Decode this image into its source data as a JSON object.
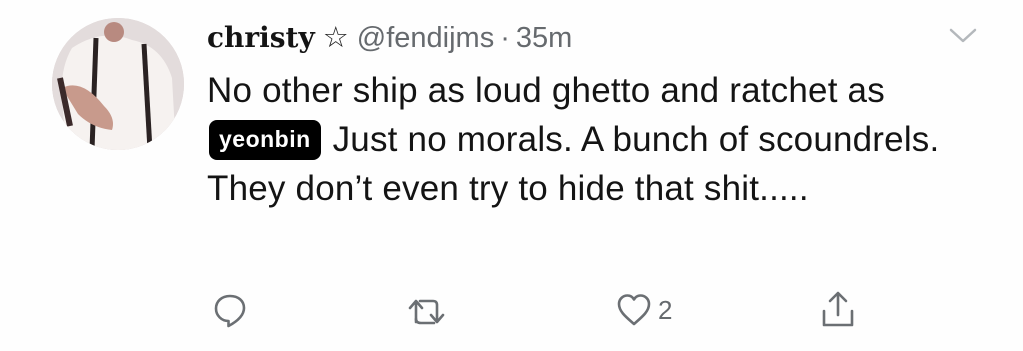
{
  "tweet": {
    "display_name": "christy",
    "star": "☆",
    "handle": "@fendijms",
    "separator": "·",
    "time": "35m",
    "text_before": "No other ship as loud ghetto and ratchet as",
    "redacted_label": "yeonbin",
    "text_after": "Just no morals. A bunch of scoundrels. They don’t even try to hide that shit.....",
    "avatar_icon": "profile-avatar"
  },
  "actions": {
    "reply_icon": "reply-icon",
    "retweet_icon": "retweet-icon",
    "like_icon": "heart-icon",
    "like_count": "2",
    "share_icon": "share-icon"
  },
  "colors": {
    "text": "#141414",
    "muted": "#666a6e",
    "redact_bg": "#000000"
  }
}
